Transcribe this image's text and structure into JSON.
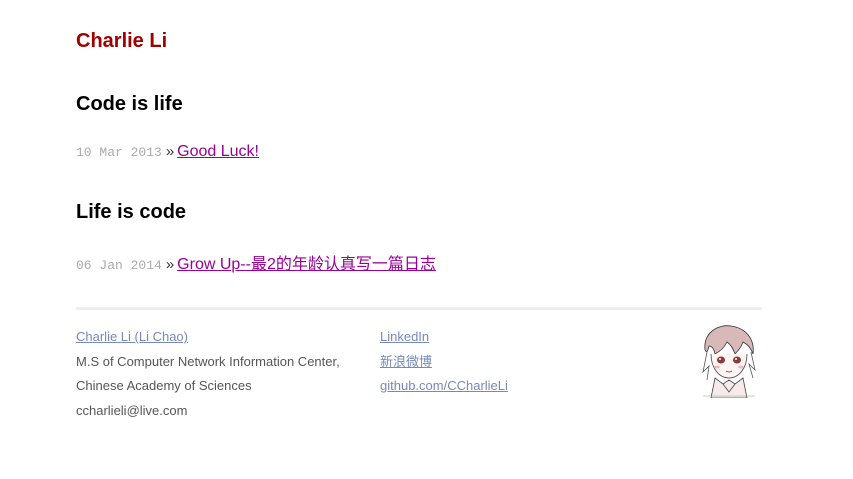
{
  "site": {
    "title": "Charlie Li"
  },
  "sections": [
    {
      "heading": "Code is life",
      "posts": [
        {
          "date": "10 Mar 2013",
          "separator": "»",
          "title": "Good Luck!"
        }
      ]
    },
    {
      "heading": "Life is code",
      "posts": [
        {
          "date": "06 Jan 2014",
          "separator": "»",
          "title": "Grow Up--最2的年龄认真写一篇日志"
        }
      ]
    }
  ],
  "footer": {
    "author_link": "Charlie Li (Li Chao)",
    "affiliation_line1": "M.S of Computer Network Information Center,",
    "affiliation_line2": "Chinese Academy of Sciences",
    "email": "ccharlieli@live.com",
    "links": [
      "LinkedIn",
      "新浪微博",
      "github.com/CCharlieLi"
    ],
    "avatar_icon": "anime-avatar-icon"
  },
  "colors": {
    "site_title": "#a00000",
    "post_link": "#990099",
    "footer_link": "#7788bb",
    "date_text": "#aaaaaa",
    "divider": "#eeeeee"
  }
}
